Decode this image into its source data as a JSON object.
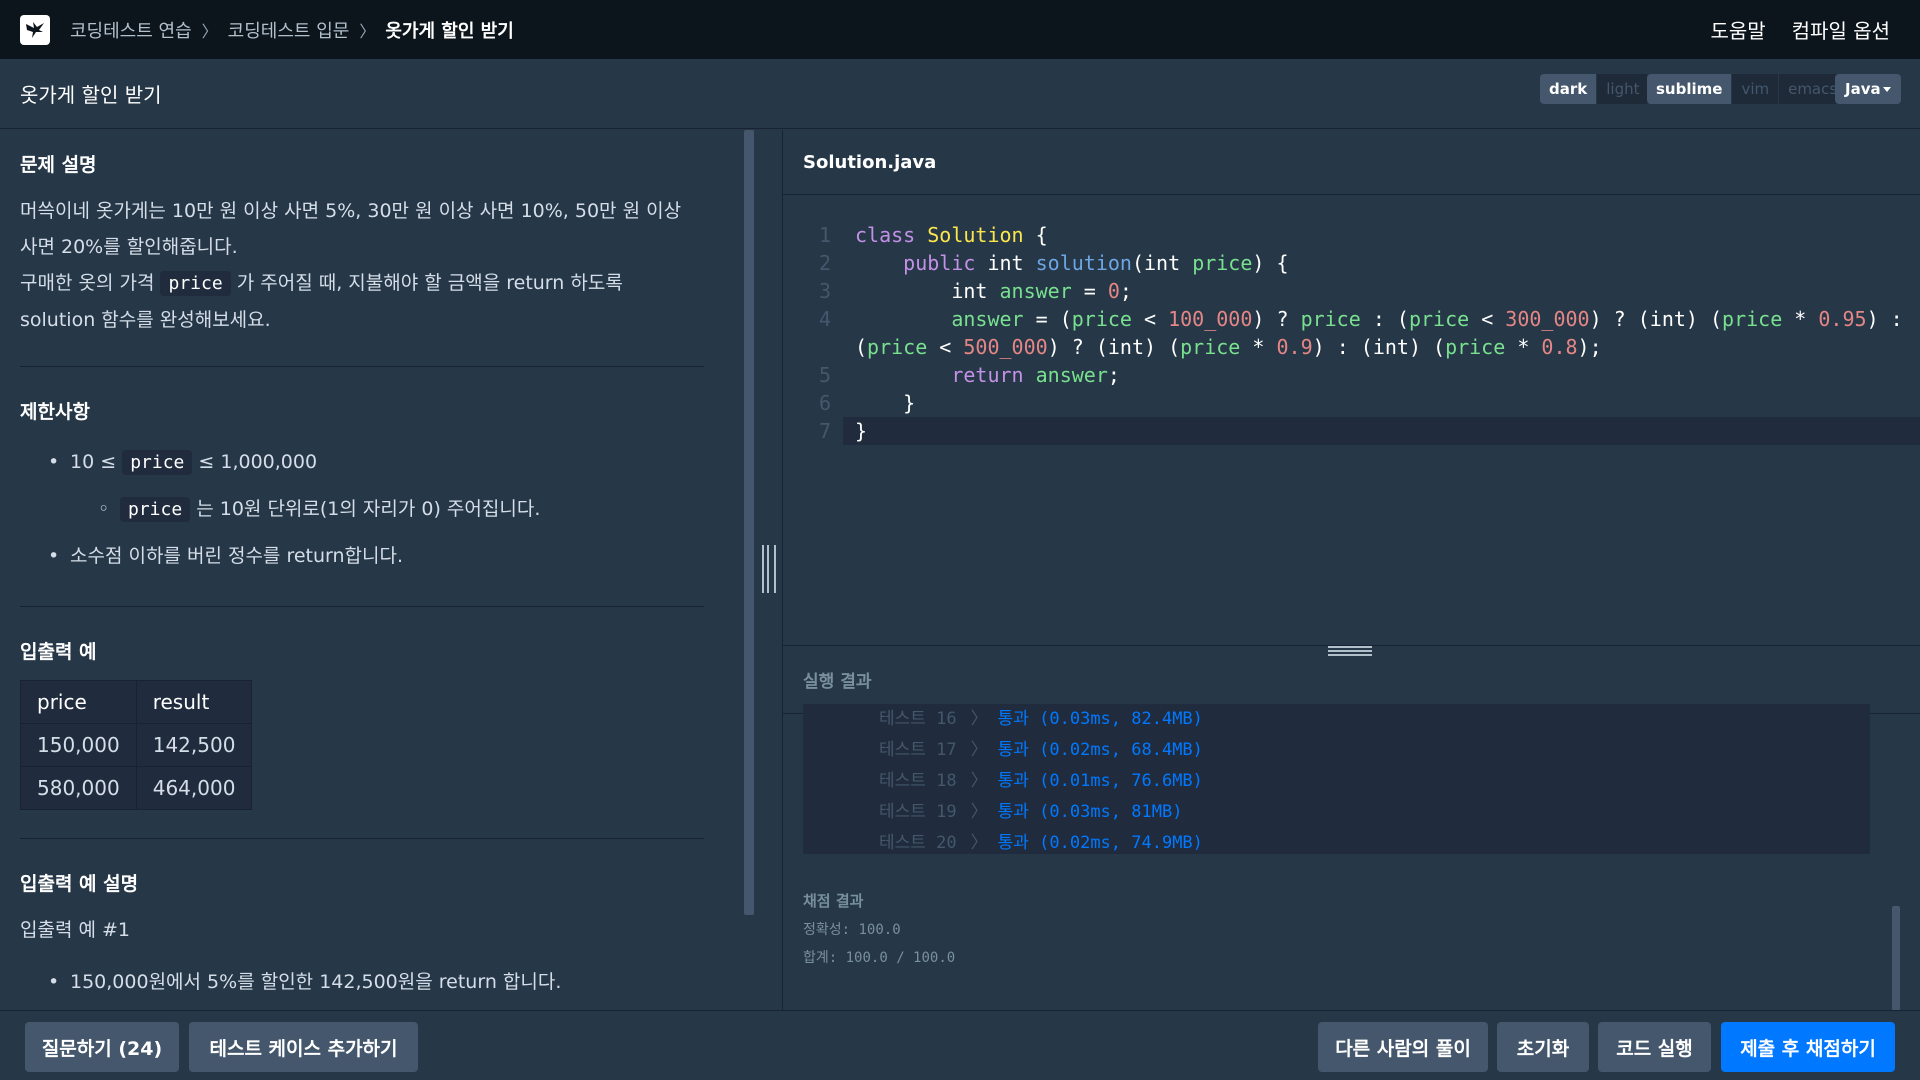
{
  "breadcrumb": [
    "코딩테스트 연습",
    "코딩테스트 입문",
    "옷가게 할인 받기"
  ],
  "top_links": {
    "help": "도움말",
    "compile_options": "컴파일 옵션"
  },
  "problem_title": "옷가게 할인 받기",
  "editor_settings": {
    "theme": [
      "dark",
      "light"
    ],
    "theme_selected": "dark",
    "keymap": [
      "sublime",
      "vim",
      "emacs"
    ],
    "keymap_selected": "sublime",
    "language": "Java"
  },
  "description": {
    "heading": "문제 설명",
    "p1": "머쓱이네 옷가게는 10만 원 이상 사면 5%, 30만 원 이상 사면 10%, 50만 원 이상 사면 20%를 할인해줍니다.",
    "p2_before": "구매한 옷의 가격 ",
    "p2_code": "price",
    "p2_after": " 가 주어질 때, 지불해야 할 금액을 return 하도록 solution 함수를 완성해보세요."
  },
  "constraints": {
    "heading": "제한사항",
    "c1_before": "10 ≤ ",
    "c1_code": "price",
    "c1_after": " ≤ 1,000,000",
    "c1_sub_code": "price",
    "c1_sub_after": "는 10원 단위로(1의 자리가 0) 주어집니다.",
    "c2": "소수점 이하를 버린 정수를 return합니다."
  },
  "examples": {
    "heading": "입출력 예",
    "headers": [
      "price",
      "result"
    ],
    "rows": [
      [
        "150,000",
        "142,500"
      ],
      [
        "580,000",
        "464,000"
      ]
    ]
  },
  "example_explain": {
    "heading": "입출력 예 설명",
    "sub": "입출력 예 #1",
    "b1": "150,000원에서 5%를 할인한 142,500원을 return 합니다."
  },
  "file_name": "Solution.java",
  "results": {
    "title": "실행 결과",
    "tests": [
      {
        "name": "테스트 16",
        "result": "통과 (0.03ms, 82.4MB)"
      },
      {
        "name": "테스트 17",
        "result": "통과 (0.02ms, 68.4MB)"
      },
      {
        "name": "테스트 18",
        "result": "통과 (0.01ms, 76.6MB)"
      },
      {
        "name": "테스트 19",
        "result": "통과 (0.03ms, 81MB)"
      },
      {
        "name": "테스트 20",
        "result": "통과 (0.02ms, 74.9MB)"
      }
    ],
    "grade_title": "채점 결과",
    "accuracy": "정확성: 100.0",
    "total": "합계: 100.0 / 100.0"
  },
  "buttons": {
    "ask": "질문하기 (24)",
    "add_testcase": "테스트 케이스 추가하기",
    "others_solution": "다른 사람의 풀이",
    "reset": "초기화",
    "run": "코드 실행",
    "submit": "제출 후 채점하기"
  },
  "colors": {
    "bg": "#263747",
    "topbar": "#0c151c",
    "primary": "#0078ff",
    "pass": "#0078ff"
  }
}
